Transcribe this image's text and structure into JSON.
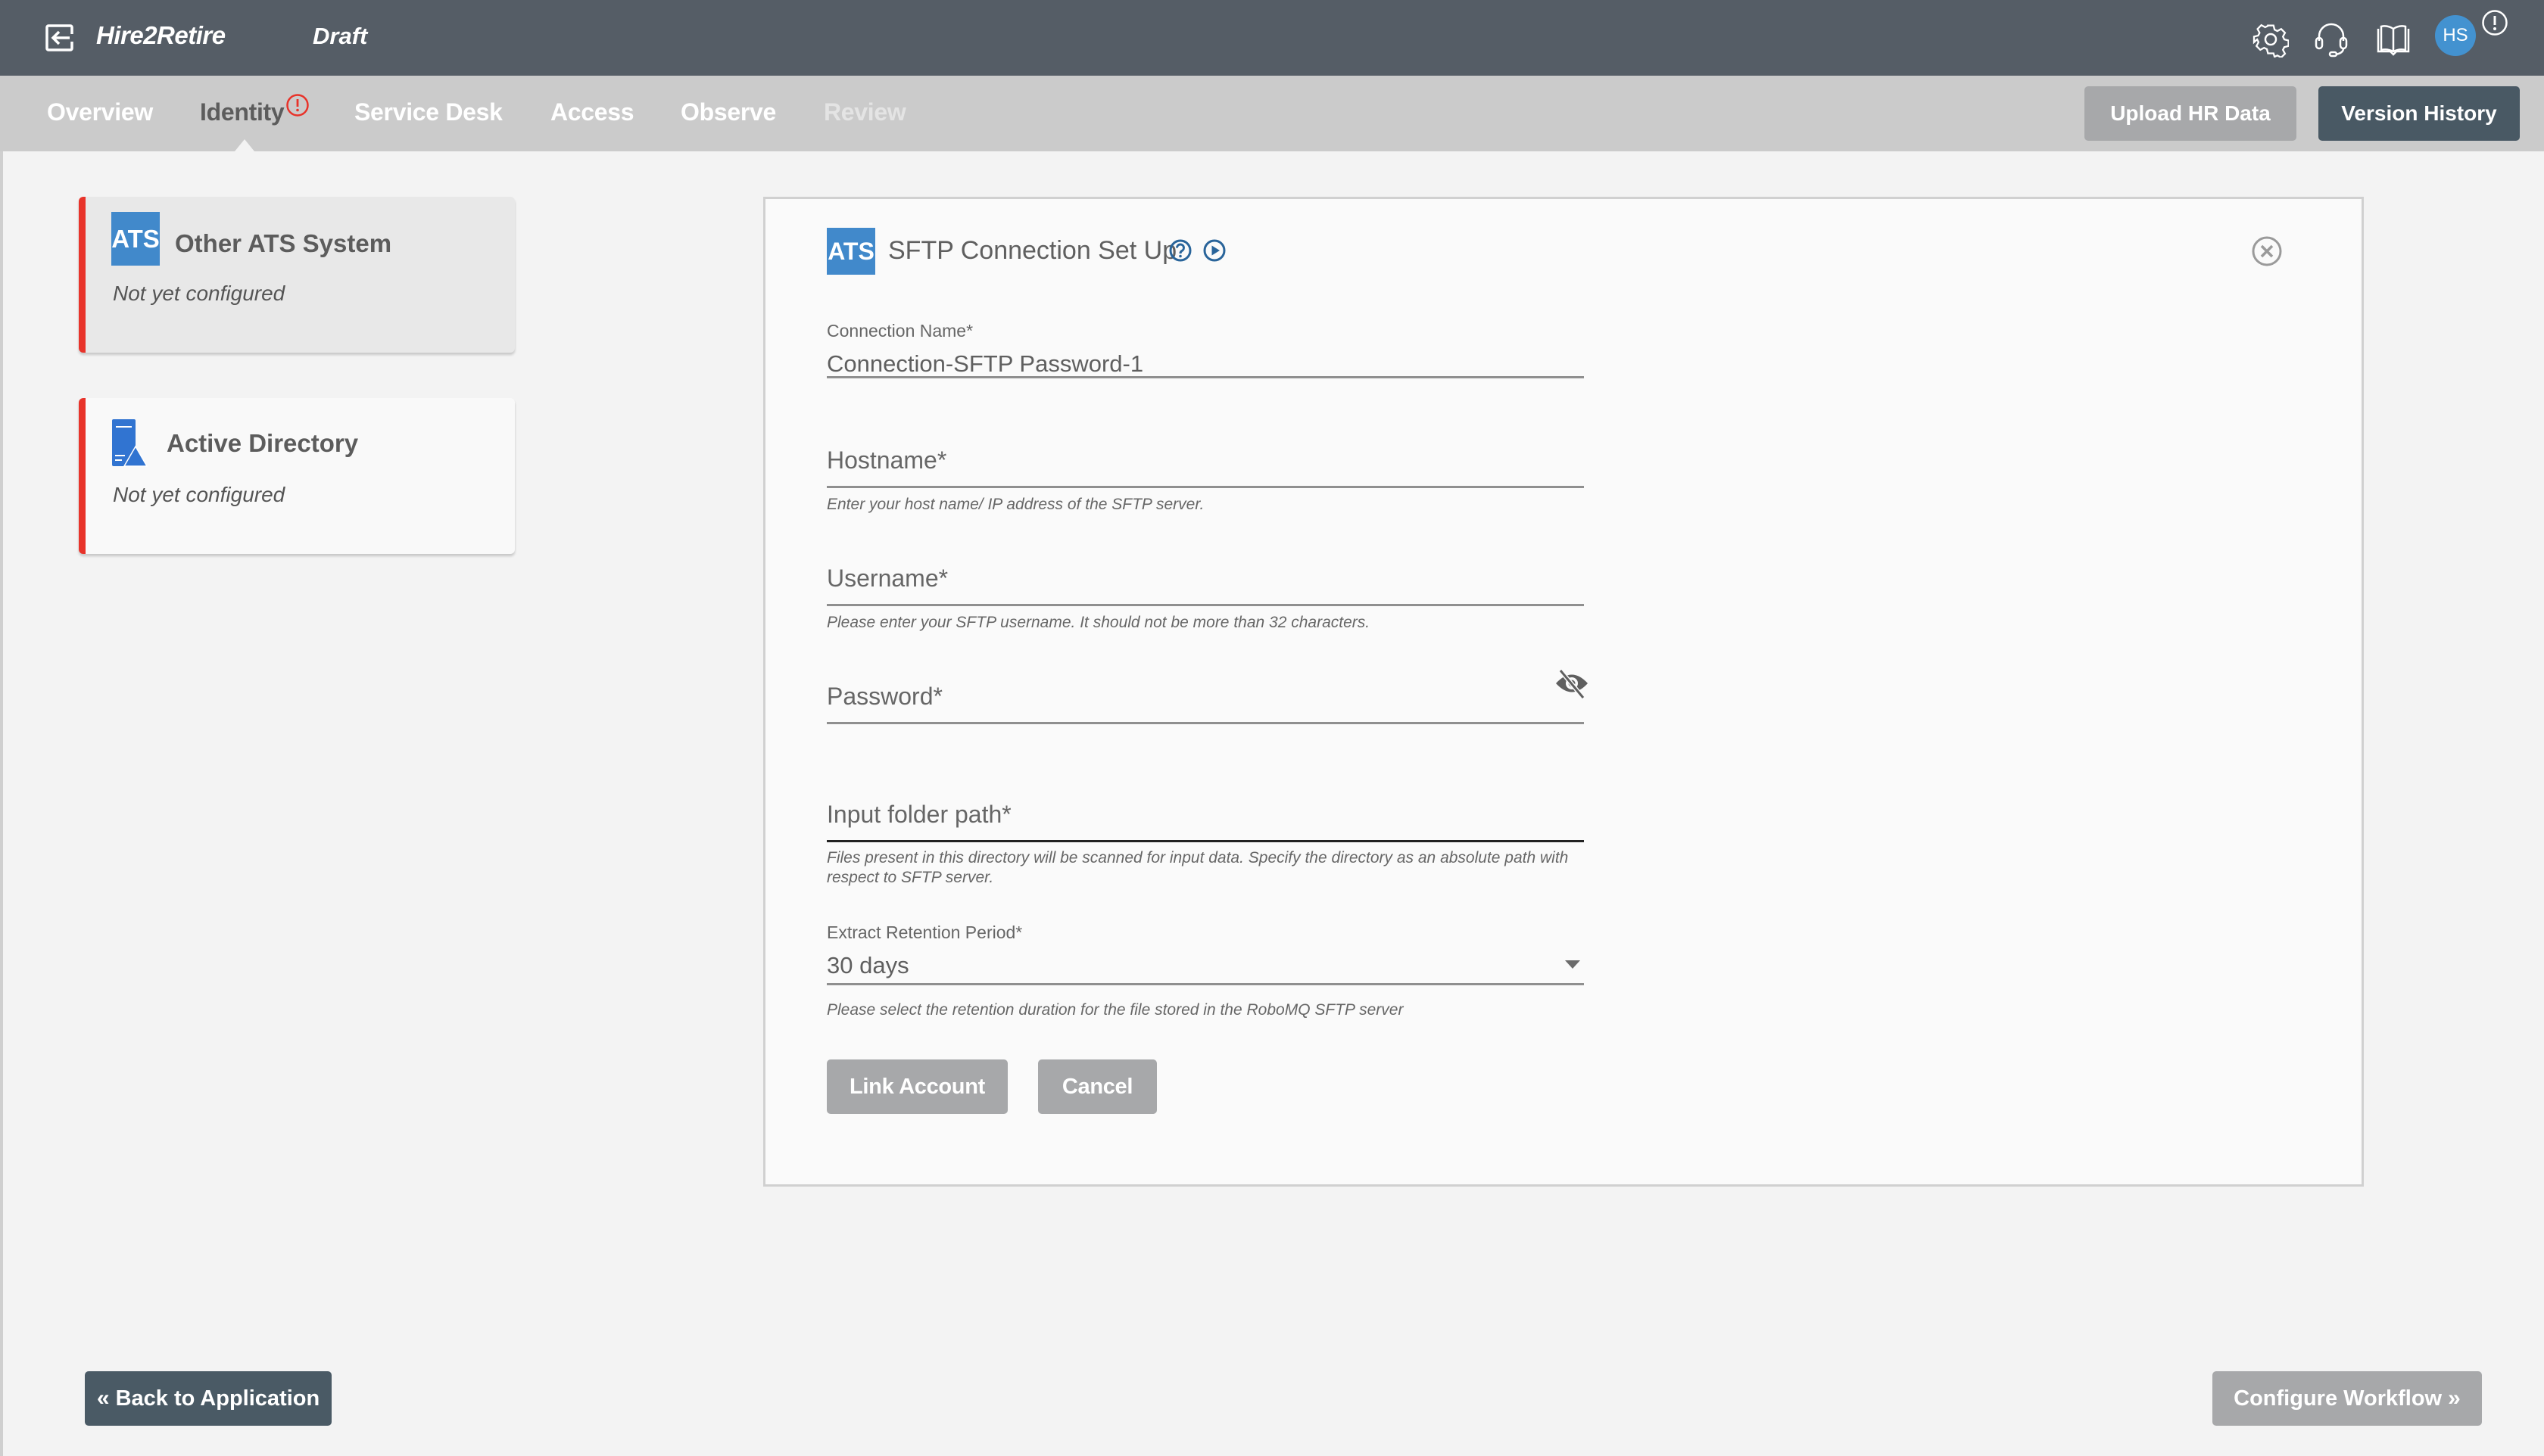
{
  "header": {
    "app_title": "Hire2Retire",
    "status": "Draft",
    "avatar_initials": "HS",
    "icons": [
      "exit-icon",
      "gear-icon",
      "headset-icon",
      "book-icon",
      "alert-icon"
    ]
  },
  "nav": {
    "tabs": [
      {
        "label": "Overview",
        "state": "normal"
      },
      {
        "label": "Identity",
        "state": "active",
        "badge": "alert"
      },
      {
        "label": "Service Desk",
        "state": "normal"
      },
      {
        "label": "Access",
        "state": "normal"
      },
      {
        "label": "Observe",
        "state": "normal"
      },
      {
        "label": "Review",
        "state": "disabled"
      }
    ],
    "upload_label": "Upload HR Data",
    "version_label": "Version History"
  },
  "sidebar": {
    "cards": [
      {
        "title": "Other ATS System",
        "status": "Not yet configured",
        "logo_text": "ATS",
        "selected": true
      },
      {
        "title": "Active Directory",
        "status": "Not yet configured",
        "icon": "active-directory-icon",
        "selected": false
      }
    ]
  },
  "panel": {
    "logo_text": "ATS",
    "title": "SFTP Connection Set Up",
    "fields": {
      "connection_name": {
        "label": "Connection Name*",
        "value": "Connection-SFTP Password-1"
      },
      "hostname": {
        "label": "Hostname*",
        "value": "",
        "hint": "Enter your host name/ IP address of the SFTP server."
      },
      "username": {
        "label": "Username*",
        "value": "",
        "hint": "Please enter your SFTP username. It should not be more than 32 characters."
      },
      "password": {
        "label": "Password*",
        "value": ""
      },
      "input_folder": {
        "label": "Input folder path*",
        "value": "",
        "hint": "Files present in this directory will be scanned for input data. Specify the directory as an absolute path with respect to SFTP server."
      },
      "retention": {
        "label": "Extract Retention Period*",
        "value": "30 days",
        "hint": "Please select the retention duration for the file stored in the RoboMQ SFTP server"
      }
    },
    "link_label": "Link Account",
    "cancel_label": "Cancel"
  },
  "footer": {
    "back_label": "Back to Application",
    "back_chevron": "«",
    "config_label": "Configure Workflow",
    "config_chevron": "»"
  },
  "colors": {
    "topbar": "#555d66",
    "navbar": "#cbcbcb",
    "accent_blue": "#4189cb",
    "alert_red": "#e8332a",
    "dark_button": "#495964",
    "disabled_button": "#a7a8aa"
  }
}
